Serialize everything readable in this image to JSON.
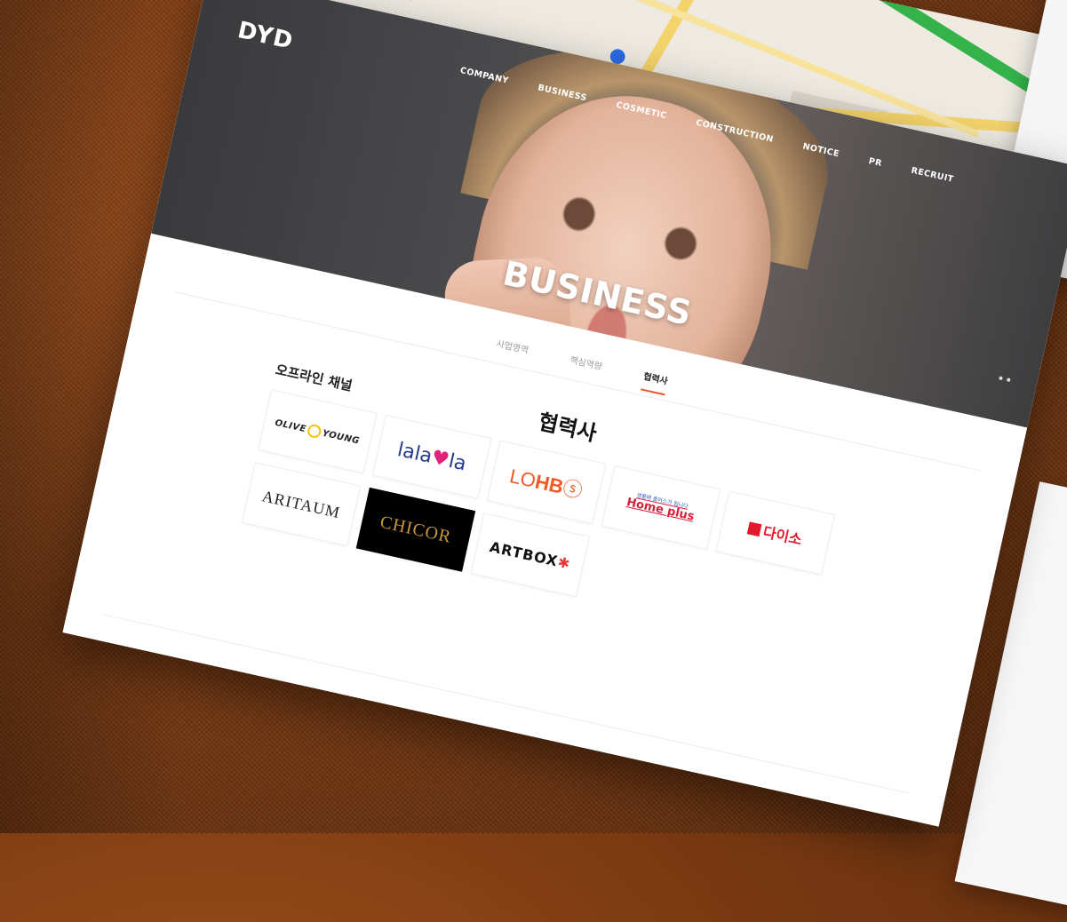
{
  "brand": {
    "logo": "DYD"
  },
  "nav": [
    {
      "label": "COMPANY"
    },
    {
      "label": "BUSINESS"
    },
    {
      "label": "COSMETIC"
    },
    {
      "label": "CONSTRUCTION"
    },
    {
      "label": "NOTICE"
    },
    {
      "label": "PR"
    },
    {
      "label": "RECRUIT"
    }
  ],
  "hero": {
    "title": "BUSINESS"
  },
  "tabs": [
    {
      "label": "사업영역",
      "active": false
    },
    {
      "label": "핵심역량",
      "active": false
    },
    {
      "label": "협력사",
      "active": true
    }
  ],
  "section": {
    "title": "협력사",
    "channel_label": "오프라인 채널"
  },
  "partners": {
    "olive_young": "OLIVE",
    "olive_young_2": "YOUNG",
    "lalavla_1": "lala",
    "lalavla_heart": "♥",
    "lalavla_2": "la",
    "lohbs_1": "LO",
    "lohbs_2": "HB",
    "lohbs_3": "ⓢ",
    "homeplus_tag": "생활에 플러스가 됩니다",
    "homeplus": "Home plus",
    "daiso": "다이소",
    "aritaum": "ARITAUM",
    "chicor": "CHICOR",
    "artbox": "ARTBOX",
    "artbox_star": "✱"
  },
  "colors": {
    "accent": "#e9572b",
    "hero_bg": "#3a3a3c",
    "background": "#7a3a12"
  }
}
